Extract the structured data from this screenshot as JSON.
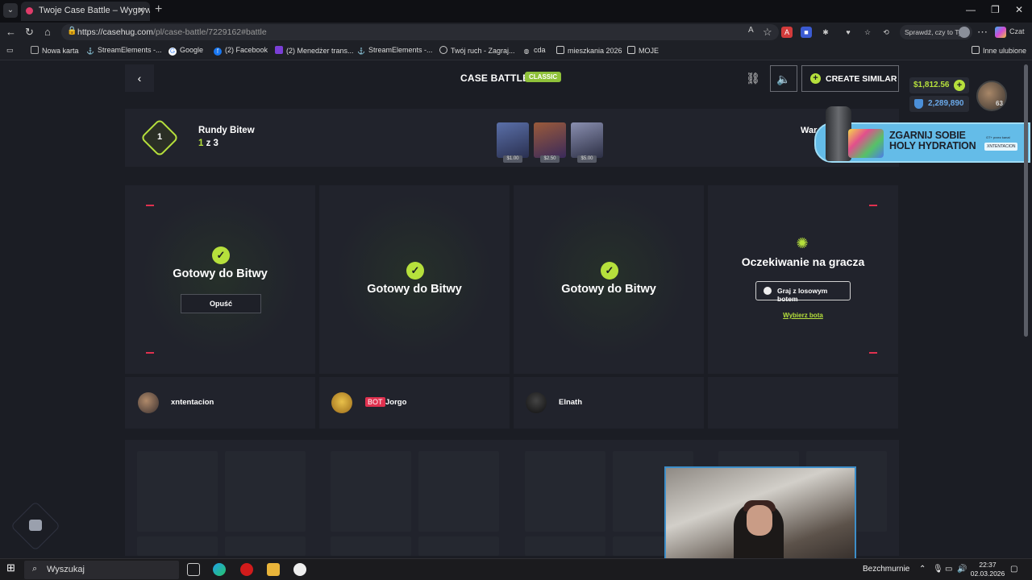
{
  "browser": {
    "tab_title": "Twoje Case Battle – Wygrywaj skin",
    "url_domain": "https://casehug.com",
    "url_path": "/pl/case-battle/7229162#battle",
    "check_pill": "Sprawdź, czy to Ty",
    "chat_label": "Czat",
    "bookmarks": [
      "Nowa karta",
      "StreamElements -...",
      "Google",
      "(2) Facebook",
      "(2) Menedżer trans...",
      "StreamElements -...",
      "Twój ruch - Zagraj...",
      "cda",
      "mieszkania 2026",
      "MOJE"
    ],
    "other_bookmarks": "Inne ulubione"
  },
  "header": {
    "title": "CASE BATTLE",
    "mode_badge": "CLASSIC",
    "create_similar": "CREATE SIMILAR",
    "balance": "$1,812.56",
    "coins": "2,289,890",
    "level": "63"
  },
  "rounds": {
    "current_round": "1",
    "label": "Rundy Bitew",
    "current": "1",
    "separator": " z ",
    "total": "3",
    "cases": [
      {
        "price": "$1.00",
        "color": "#3a4a7a"
      },
      {
        "price": "$2.50",
        "color": "#6a3a2a"
      },
      {
        "price": "$5.00",
        "color": "#4a4f66"
      }
    ],
    "value_label": "War"
  },
  "ad": {
    "headline": "ZGARNIJ SOBIE HOLY HYDRATION",
    "small": "GT+ przez kanał",
    "tag": "XNTENTACION"
  },
  "players": [
    {
      "status": "Gotowy do Bitwy",
      "name": "xntentacion",
      "is_bot": false
    },
    {
      "status": "Gotowy do Bitwy",
      "name": "Jorgo",
      "is_bot": true
    },
    {
      "status": "Gotowy do Bitwy",
      "name": "Elnath",
      "is_bot": false
    }
  ],
  "leave_button": "Opuść",
  "bot_badge": "BOT",
  "waiting": {
    "text": "Oczekiwanie na gracza",
    "random_bot": "Graj z losowym botem",
    "choose_bot": "Wybierz bota"
  },
  "taskbar": {
    "search": "Wyszukaj",
    "weather": "Bezchmurnie",
    "time": "22:37",
    "date": "02.03.2026"
  }
}
